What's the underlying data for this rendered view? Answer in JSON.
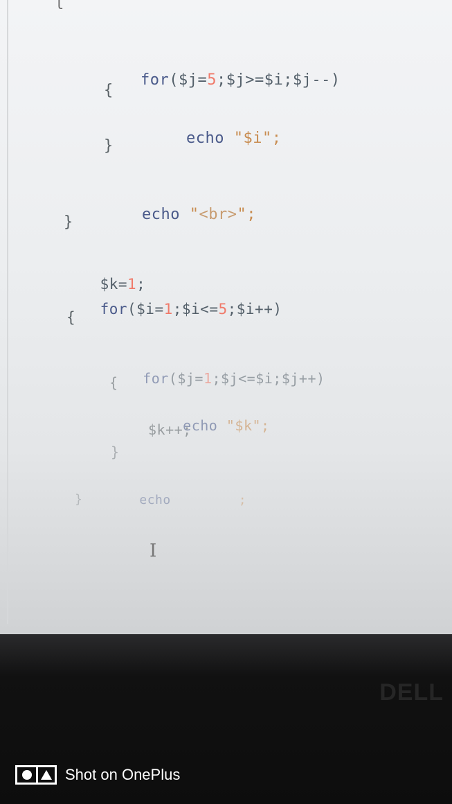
{
  "code": {
    "top_fragment": "l",
    "line1": {
      "kw": "for",
      "a": "($j=",
      "n": "5",
      "b": ";$j>=$i;$j--)"
    },
    "line2": "{",
    "line3": {
      "kw": "echo",
      "s": "\"$i\";"
    },
    "line4": "}",
    "line5": {
      "kw": "echo",
      "s1": "\"",
      "tag": "<br>",
      "s2": "\";"
    },
    "line6": "}",
    "line7": {
      "a": "$k=",
      "n": "1",
      "b": ";"
    },
    "line8": {
      "kw": "for",
      "a": "($i=",
      "n1": "1",
      "b": ";$i<=",
      "n2": "5",
      "c": ";$i++)"
    },
    "line9": "{",
    "line10": {
      "kw": "for",
      "a": "($j=",
      "n": "1",
      "b": ";$j<=$i;$j++)"
    },
    "line11": "{",
    "line12": {
      "kw": "echo",
      "s": "\"$k\";"
    },
    "line13": "$k++;",
    "line14": "}",
    "line15": {
      "kw": "echo",
      "s": ";"
    },
    "line16": "}"
  },
  "icons": {
    "text_cursor": "I-beam",
    "watermark": "oneplus-camera"
  },
  "watermark": {
    "text": "Shot on OnePlus"
  },
  "bezel": {
    "brand": "DELL"
  }
}
